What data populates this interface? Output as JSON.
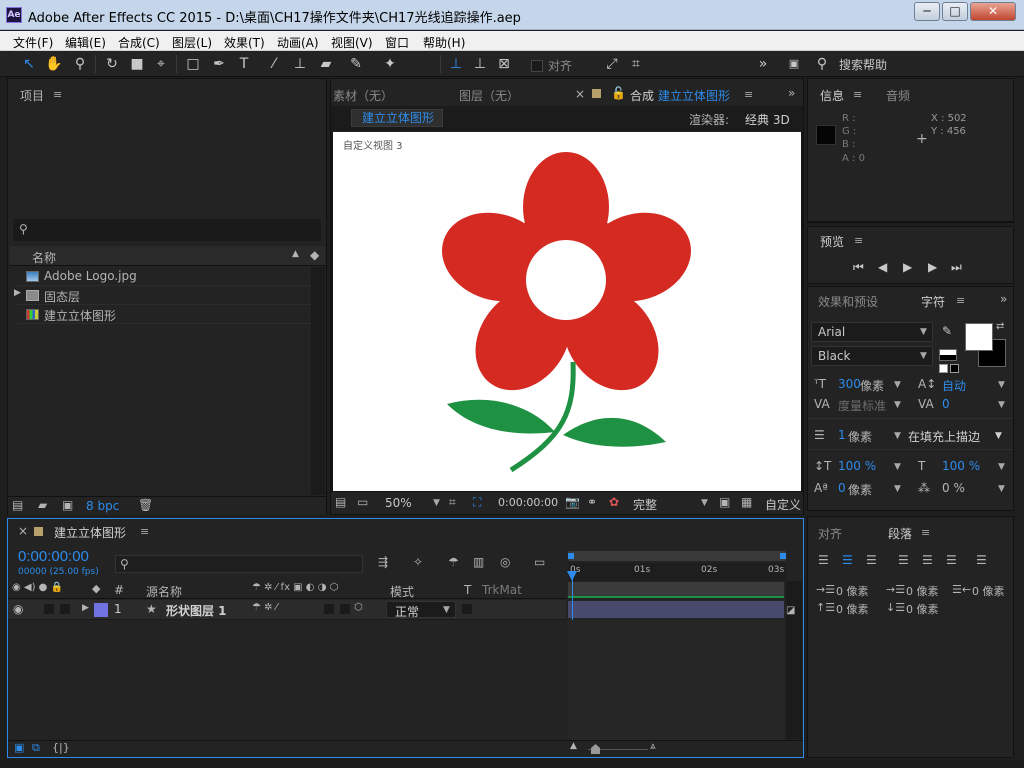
{
  "titlebar": {
    "title": "Adobe After Effects CC 2015 - D:\\桌面\\CH17操作文件夹\\CH17光线追踪操作.aep",
    "logo": "Ae",
    "buttons": [
      "─",
      "□",
      "✕"
    ]
  },
  "menu": [
    "文件(F)",
    "编辑(E)",
    "合成(C)",
    "图层(L)",
    "效果(T)",
    "动画(A)",
    "视图(V)",
    "窗口",
    "帮助(H)"
  ],
  "toolbar": {
    "align_label": "对齐",
    "help_label": "搜索帮助"
  },
  "project": {
    "title": "项目",
    "col_name": "名称",
    "items": [
      {
        "label": "Adobe Logo.jpg",
        "icon": "image-file-icon"
      },
      {
        "label": "固态层",
        "icon": "folder-icon"
      },
      {
        "label": "建立立体图形",
        "icon": "composition-icon"
      }
    ],
    "bpc": "8 bpc"
  },
  "viewer": {
    "tab_footage": "素材（无）",
    "tab_layer": "图层（无）",
    "tab_comp_prefix": "合成",
    "tab_comp_name": "建立立体图形",
    "comp_button": "建立立体图形",
    "renderer_label": "渲染器:",
    "renderer_value": "经典 3D",
    "view_label": "自定义视图 3",
    "zoom": "50%",
    "timecode": "0:00:00:00",
    "quality": "完整",
    "view_menu": "自定义"
  },
  "info": {
    "tab_info": "信息",
    "tab_audio": "音频",
    "r": "R :",
    "g": "G :",
    "b": "B :",
    "a": "A : 0",
    "x": "X : 502",
    "y": "Y : 456"
  },
  "preview": {
    "title": "预览"
  },
  "character": {
    "tab_effects": "效果和预设",
    "tab_char": "字符",
    "font": "Arial",
    "style": "Black",
    "size_value": "300",
    "size_unit": "像素",
    "leading": "自动",
    "kerning": "度量标准",
    "tracking": "0",
    "stroke_value": "1",
    "stroke_unit": "像素",
    "stroke_mode": "在填充上描边",
    "vscale": "100 %",
    "hscale": "100 %",
    "baseline_value": "0",
    "baseline_unit": "像素",
    "tsume": "0 %"
  },
  "paragraph": {
    "tab_align": "对齐",
    "tab_para": "段落",
    "indent_value": "0 像素"
  },
  "timeline": {
    "comp_name": "建立立体图形",
    "timecode": "0:00:00:00",
    "frame_info": "00000 (25.00 fps)",
    "col_hash": "#",
    "col_source": "源名称",
    "col_mode": "模式",
    "col_t": "T",
    "col_trkmat": "TrkMat",
    "layer_num": "1",
    "layer_name": "形状图层 1",
    "layer_mode": "正常",
    "ruler": [
      "0s",
      "01s",
      "02s",
      "03s"
    ]
  },
  "colors": {
    "accent": "#2d8ceb",
    "flower": "#d42a22",
    "leaf": "#1f9142",
    "layer_bar": "#47496d",
    "label": "#6f72e0"
  }
}
